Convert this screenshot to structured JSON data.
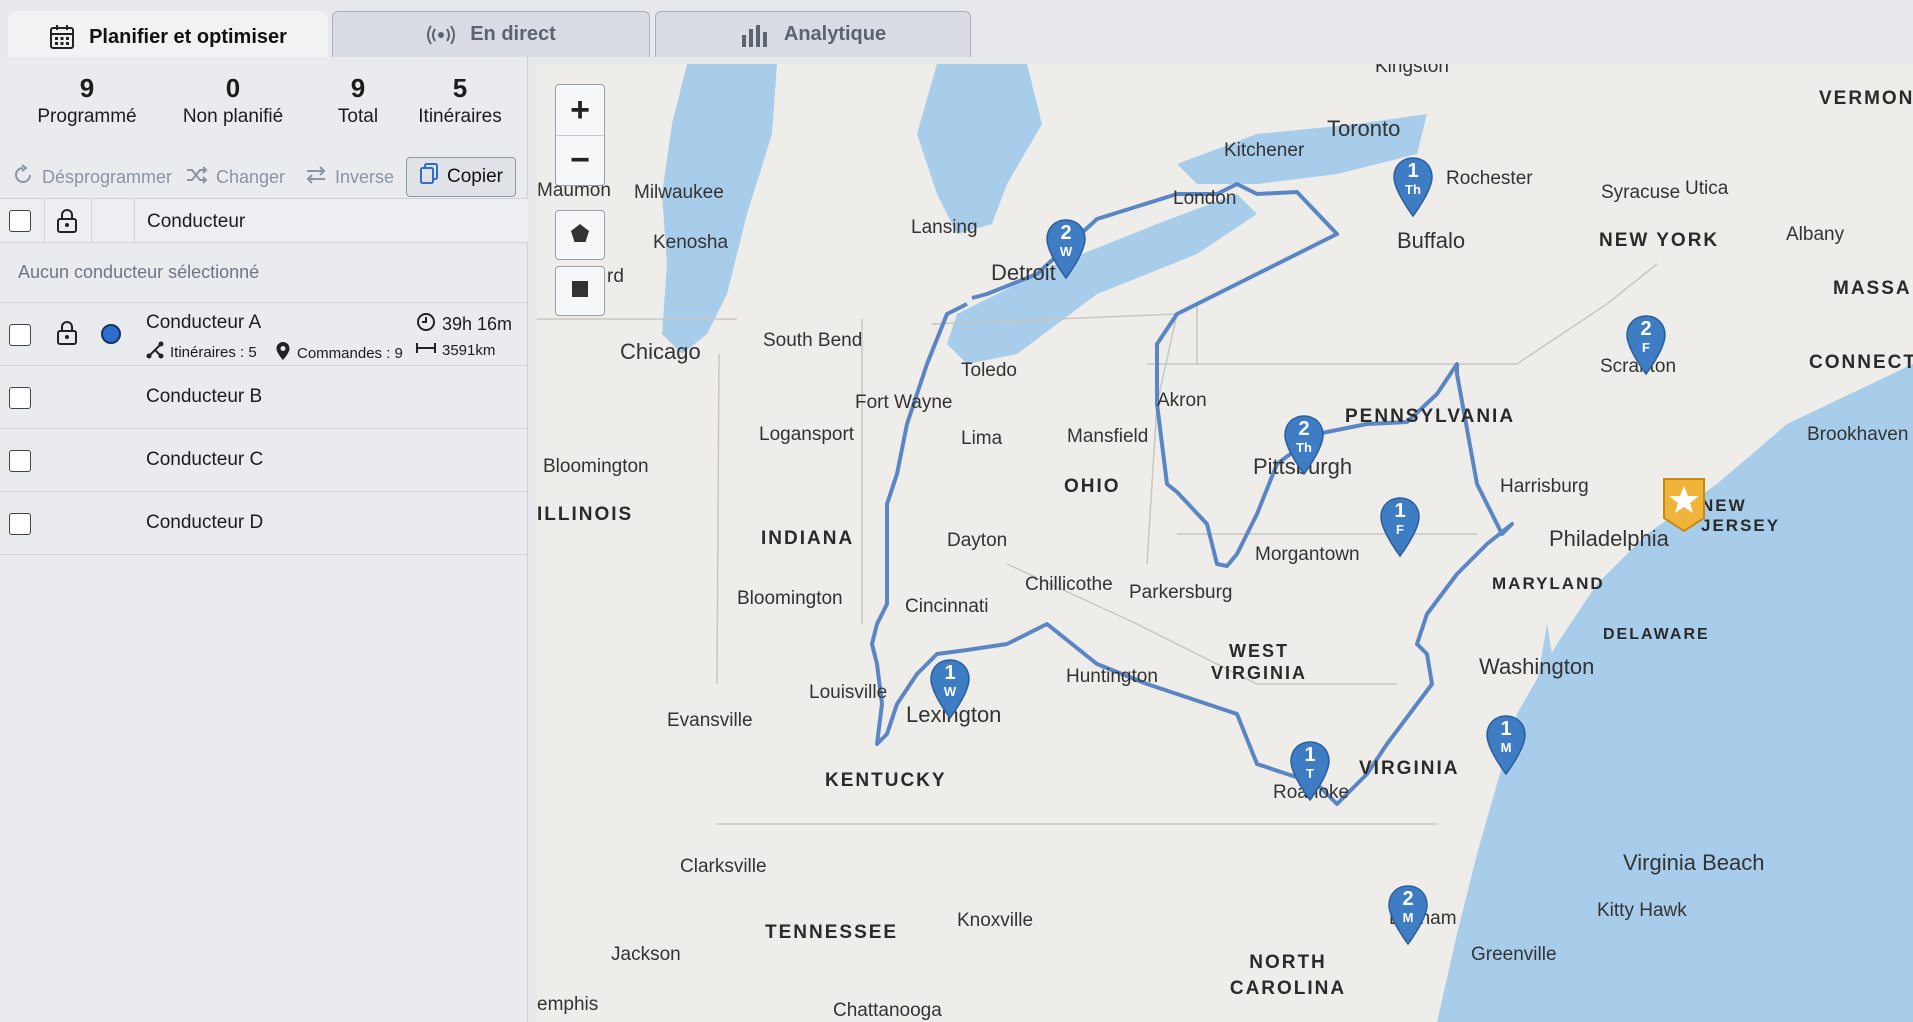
{
  "tabs": [
    {
      "label": "Planifier et optimiser",
      "icon": "calendar-icon",
      "active": true
    },
    {
      "label": "En direct",
      "icon": "broadcast-icon",
      "active": false
    },
    {
      "label": "Analytique",
      "icon": "bar-chart-icon",
      "active": false
    }
  ],
  "stats": [
    {
      "value": "9",
      "label": "Programmé"
    },
    {
      "value": "0",
      "label": "Non planifié"
    },
    {
      "value": "9",
      "label": "Total"
    },
    {
      "value": "5",
      "label": "Itinéraires"
    }
  ],
  "actions": {
    "unschedule": "Désprogrammer",
    "change": "Changer",
    "reverse": "Inverse",
    "copy": "Copier"
  },
  "table": {
    "driver_header": "Conducteur",
    "no_selection": "Aucun conducteur sélectionné"
  },
  "drivers": [
    {
      "name": "Conducteur A",
      "duration": "39h 16m",
      "routes": "Itinéraires : 5",
      "orders": "Commandes : 9",
      "distance": "3591km",
      "color": "#2f6cd0"
    },
    {
      "name": "Conducteur B"
    },
    {
      "name": "Conducteur C"
    },
    {
      "name": "Conducteur D"
    }
  ],
  "map": {
    "cities": [
      "Kingston",
      "Toronto",
      "Kitchener",
      "London",
      "Milwaukee",
      "Kenosha",
      "Lansing",
      "Detroit",
      "Rochester",
      "Syracuse",
      "Utica",
      "Albany",
      "Buffalo",
      "Chicago",
      "South Bend",
      "Toledo",
      "Fort Wayne",
      "Logansport",
      "Lima",
      "Mansfield",
      "Akron",
      "Pittsburgh",
      "Scranton",
      "Harrisburg",
      "Philadelphia",
      "Bloomington",
      "Dayton",
      "Cincinnati",
      "Chillicothe",
      "Parkersburg",
      "Morgantown",
      "Bloomington",
      "Louisville",
      "Lexington",
      "Huntington",
      "Evansville",
      "Roanoke",
      "Washington",
      "Clarksville",
      "Knoxville",
      "Durham",
      "Greenville",
      "Jackson",
      "Chattanooga",
      "Virginia Beach",
      "Kitty Hawk",
      "Brookhaven",
      "emphis",
      "rd",
      "Maumon"
    ],
    "states": [
      "VERMONT",
      "NEW YORK",
      "MASSA",
      "CONNECTIC",
      "PENNSYLVANIA",
      "OHIO",
      "INDIANA",
      "ILLINOIS",
      "NEW JERSEY",
      "MARYLAND",
      "DELAWARE",
      "WEST VIRGINIA",
      "VIRGINIA",
      "KENTUCKY",
      "TENNESSEE",
      "NORTH CAROLINA"
    ],
    "stops": [
      {
        "number": "1",
        "day": "Th"
      },
      {
        "number": "2",
        "day": "W"
      },
      {
        "number": "2",
        "day": "F"
      },
      {
        "number": "2",
        "day": "Th"
      },
      {
        "number": "1",
        "day": "F"
      },
      {
        "number": "1",
        "day": "W"
      },
      {
        "number": "1",
        "day": "T"
      },
      {
        "number": "1",
        "day": "M"
      },
      {
        "number": "2",
        "day": "M"
      }
    ],
    "zoom_in": "+",
    "zoom_out": "−",
    "route_color": "#5b86c5",
    "pin_color": "#3e7cc4",
    "depot_color": "#f0b43a",
    "water_color": "#a7cdea",
    "land_color": "#eeedea"
  }
}
